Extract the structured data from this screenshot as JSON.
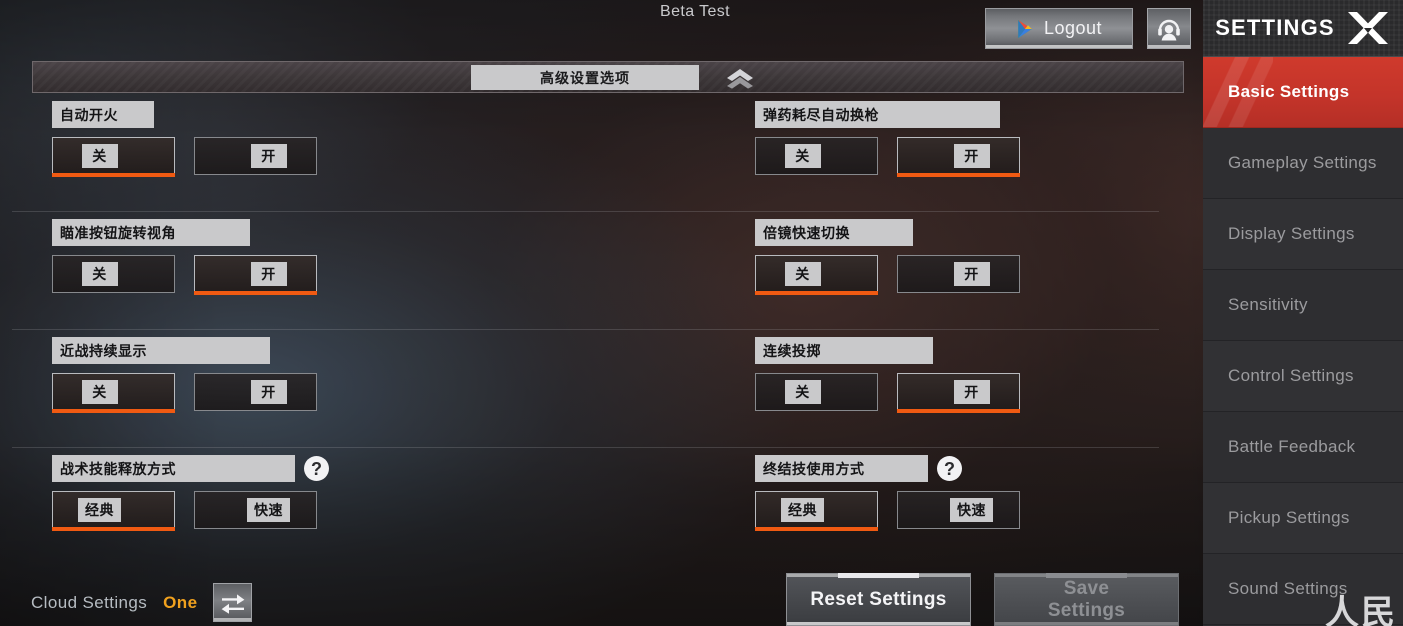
{
  "topbar": {
    "beta_title": "Beta Test",
    "logout_label": "Logout",
    "play_icon": "google-play-triangle-icon",
    "support_icon": "headset-support-icon"
  },
  "advanced": {
    "label": "高级设置选项",
    "chevron_icon": "chevron-up-icon"
  },
  "settings_rows": [
    {
      "left": {
        "label": "自动开火",
        "help": false,
        "options": [
          {
            "text": "关",
            "selected": true
          },
          {
            "text": "开",
            "selected": false
          }
        ]
      },
      "right": {
        "label": "弹药耗尽自动换枪",
        "help": false,
        "options": [
          {
            "text": "关",
            "selected": false
          },
          {
            "text": "开",
            "selected": true
          }
        ]
      }
    },
    {
      "left": {
        "label": "瞄准按钮旋转视角",
        "help": false,
        "options": [
          {
            "text": "关",
            "selected": false
          },
          {
            "text": "开",
            "selected": true
          }
        ]
      },
      "right": {
        "label": "倍镜快速切换",
        "help": false,
        "options": [
          {
            "text": "关",
            "selected": true
          },
          {
            "text": "开",
            "selected": false
          }
        ]
      }
    },
    {
      "left": {
        "label": "近战持续显示",
        "help": false,
        "options": [
          {
            "text": "关",
            "selected": true
          },
          {
            "text": "开",
            "selected": false
          }
        ]
      },
      "right": {
        "label": "连续投掷",
        "help": false,
        "options": [
          {
            "text": "关",
            "selected": false
          },
          {
            "text": "开",
            "selected": true
          }
        ]
      }
    },
    {
      "left": {
        "label": "战术技能释放方式",
        "help": true,
        "help_text": "?",
        "options": [
          {
            "text": "经典",
            "selected": true
          },
          {
            "text": "快速",
            "selected": false
          }
        ]
      },
      "right": {
        "label": "终结技使用方式",
        "help": true,
        "help_text": "?",
        "options": [
          {
            "text": "经典",
            "selected": true
          },
          {
            "text": "快速",
            "selected": false
          }
        ]
      }
    }
  ],
  "bottom": {
    "cloud_label": "Cloud Settings",
    "cloud_value": "One",
    "sync_icon": "bidirectional-sync-arrows-icon",
    "reset_label": "Reset Settings",
    "save_label": "Save\nSettings"
  },
  "sidebar": {
    "title": "SETTINGS",
    "close_icon": "close-x-icon",
    "items": [
      {
        "label": "Basic Settings",
        "active": true
      },
      {
        "label": "Gameplay Settings",
        "active": false
      },
      {
        "label": "Display Settings",
        "active": false
      },
      {
        "label": "Sensitivity",
        "active": false
      },
      {
        "label": "Control Settings",
        "active": false
      },
      {
        "label": "Battle Feedback",
        "active": false
      },
      {
        "label": "Pickup Settings",
        "active": false
      },
      {
        "label": "Sound Settings",
        "active": false
      }
    ]
  },
  "colors": {
    "accent_orange": "#f05a12",
    "sidebar_active_red": "#c4342a",
    "cloud_value_gold": "#f0a11e",
    "chip_gray": "#c9c9cb"
  }
}
